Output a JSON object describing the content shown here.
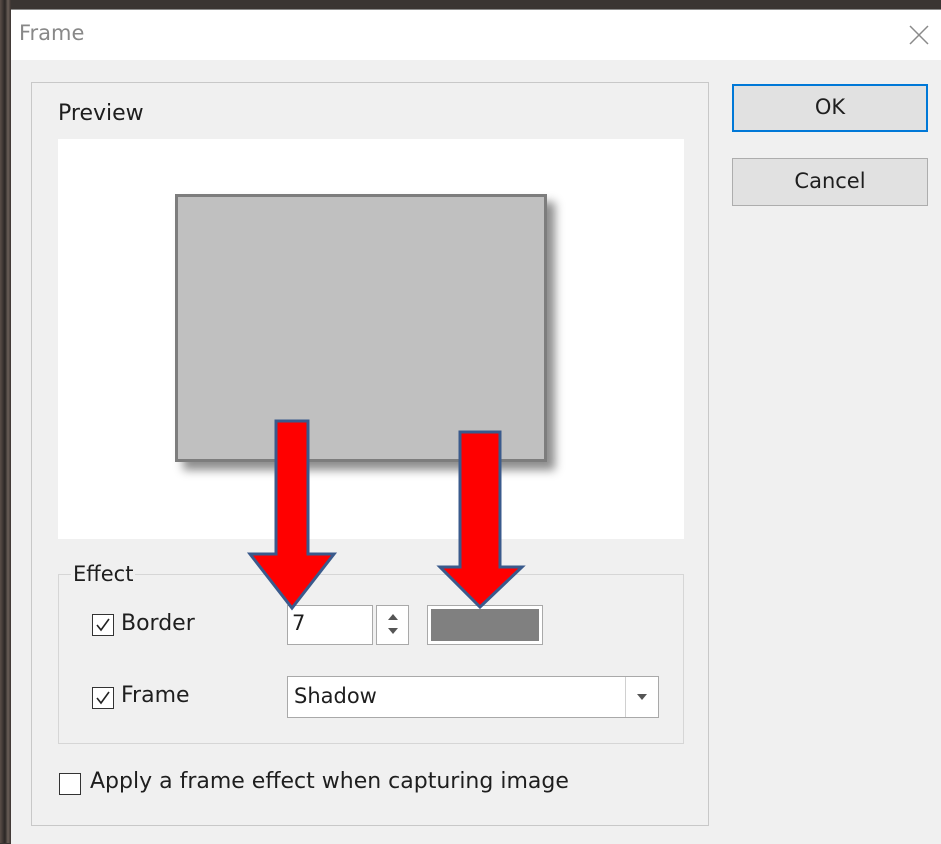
{
  "window": {
    "title": "Frame"
  },
  "buttons": {
    "ok_label": "OK",
    "cancel_label": "Cancel"
  },
  "preview": {
    "label": "Preview"
  },
  "effect": {
    "label": "Effect",
    "border": {
      "label": "Border",
      "checked": true,
      "width_value": "7",
      "color": "#808080"
    },
    "frame": {
      "label": "Frame",
      "checked": true,
      "style_value": "Shadow"
    }
  },
  "capture_option": {
    "label": "Apply a frame effect when capturing image",
    "checked": false
  },
  "annotations": {
    "arrow_color": "#ff0000",
    "arrow_outline": "#3a5a8c"
  },
  "icons": {
    "close": "close-icon",
    "check": "checkmark-icon",
    "spin_up": "spin-up-icon",
    "spin_down": "spin-down-icon",
    "dropdown": "chevron-down-icon"
  }
}
